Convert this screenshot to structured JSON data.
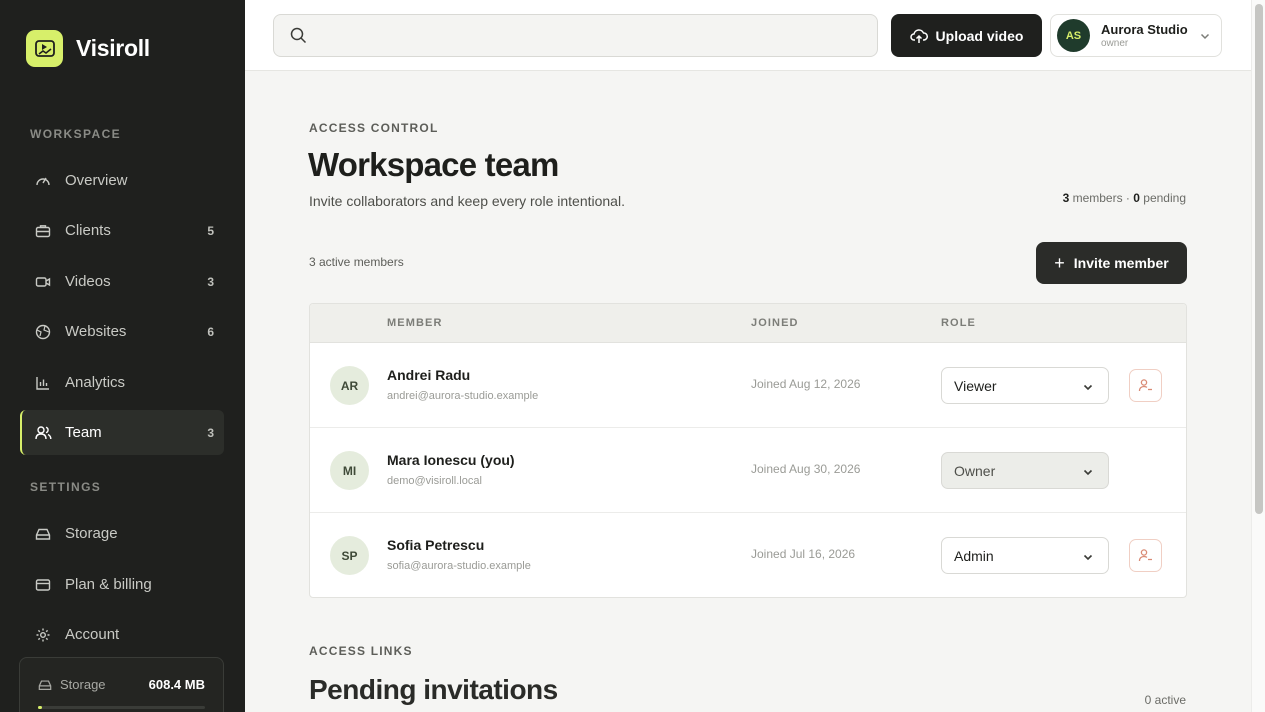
{
  "brand": {
    "name": "Visiroll",
    "accent": "#d7ef6a"
  },
  "sidebar": {
    "section_workspace": "WORKSPACE",
    "section_settings": "SETTINGS",
    "items": [
      {
        "label": "Overview",
        "count": "",
        "icon": "gauge-icon"
      },
      {
        "label": "Clients",
        "count": "5",
        "icon": "briefcase-icon"
      },
      {
        "label": "Videos",
        "count": "3",
        "icon": "video-camera-icon"
      },
      {
        "label": "Websites",
        "count": "6",
        "icon": "globe-icon"
      },
      {
        "label": "Analytics",
        "count": "",
        "icon": "bar-chart-icon"
      },
      {
        "label": "Team",
        "count": "3",
        "icon": "users-icon",
        "active": true
      }
    ],
    "settings_items": [
      {
        "label": "Storage",
        "icon": "drive-icon"
      },
      {
        "label": "Plan & billing",
        "icon": "credit-card-icon"
      },
      {
        "label": "Account",
        "icon": "gear-icon"
      }
    ],
    "storage_card": {
      "label": "Storage",
      "value": "608.4 MB"
    }
  },
  "topbar": {
    "search_placeholder": "",
    "upload_label": "Upload video",
    "account": {
      "initials": "AS",
      "name": "Aurora Studio",
      "role": "owner"
    }
  },
  "main": {
    "eyebrow": "ACCESS CONTROL",
    "title": "Workspace team",
    "subtitle": "Invite collaborators and keep every role intentional.",
    "summary": {
      "members_count": "3",
      "members_label": " members · ",
      "pending_count": "0",
      "pending_label": " pending"
    },
    "active_members": "3 active members",
    "invite_label": "Invite member",
    "table": {
      "headers": {
        "member": "MEMBER",
        "joined": "JOINED",
        "role": "ROLE"
      },
      "rows": [
        {
          "initials": "AR",
          "name": "Andrei Radu",
          "email": "andrei@aurora-studio.example",
          "joined": "Joined Aug 12, 2026",
          "role": "Viewer"
        },
        {
          "initials": "MI",
          "name": "Mara Ionescu (you)",
          "email": "demo@visiroll.local",
          "joined": "Joined Aug 30, 2026",
          "role": "Owner"
        },
        {
          "initials": "SP",
          "name": "Sofia Petrescu",
          "email": "sofia@aurora-studio.example",
          "joined": "Joined Jul 16, 2026",
          "role": "Admin"
        }
      ]
    },
    "links_eyebrow": "ACCESS LINKS",
    "pending_title": "Pending invitations",
    "pending_active": "0 active"
  }
}
